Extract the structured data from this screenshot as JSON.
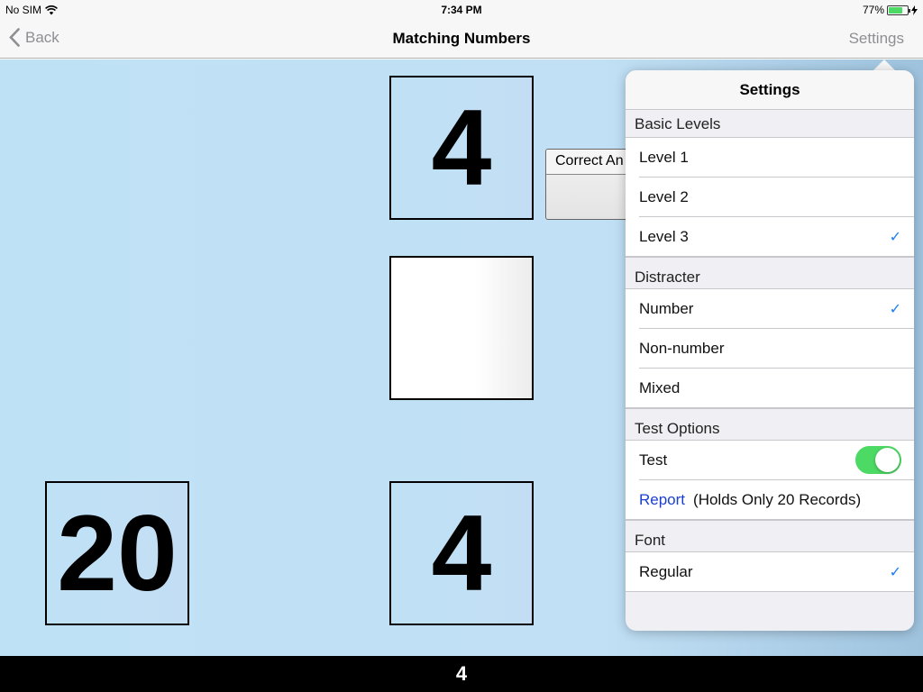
{
  "status_bar": {
    "carrier": "No SIM",
    "time": "7:34 PM",
    "battery_percent": "77%",
    "battery_level": 0.77
  },
  "nav": {
    "back_label": "Back",
    "title": "Matching Numbers",
    "settings_label": "Settings"
  },
  "game": {
    "target_card": "4",
    "answer_card": "",
    "choice_left": "20",
    "choice_right": "4",
    "correct_label": "Correct An",
    "bottom_label": "4"
  },
  "settings": {
    "title": "Settings",
    "basic_levels": {
      "header": "Basic Levels",
      "items": [
        {
          "label": "Level 1",
          "checked": false
        },
        {
          "label": "Level 2",
          "checked": false
        },
        {
          "label": "Level 3",
          "checked": true
        }
      ]
    },
    "distracter": {
      "header": "Distracter",
      "items": [
        {
          "label": "Number",
          "checked": true
        },
        {
          "label": "Non-number",
          "checked": false
        },
        {
          "label": "Mixed",
          "checked": false
        }
      ]
    },
    "test_options": {
      "header": "Test Options",
      "test_label": "Test",
      "test_enabled": true,
      "report_link": "Report",
      "report_note": "(Holds Only 20 Records)"
    },
    "font": {
      "header": "Font",
      "items": [
        {
          "label": "Regular",
          "checked": true
        }
      ]
    },
    "check_mark": "✓",
    "colors": {
      "accent": "#1b7cf2",
      "toggle_on": "#4cd964",
      "link": "#1b3fd0"
    }
  }
}
